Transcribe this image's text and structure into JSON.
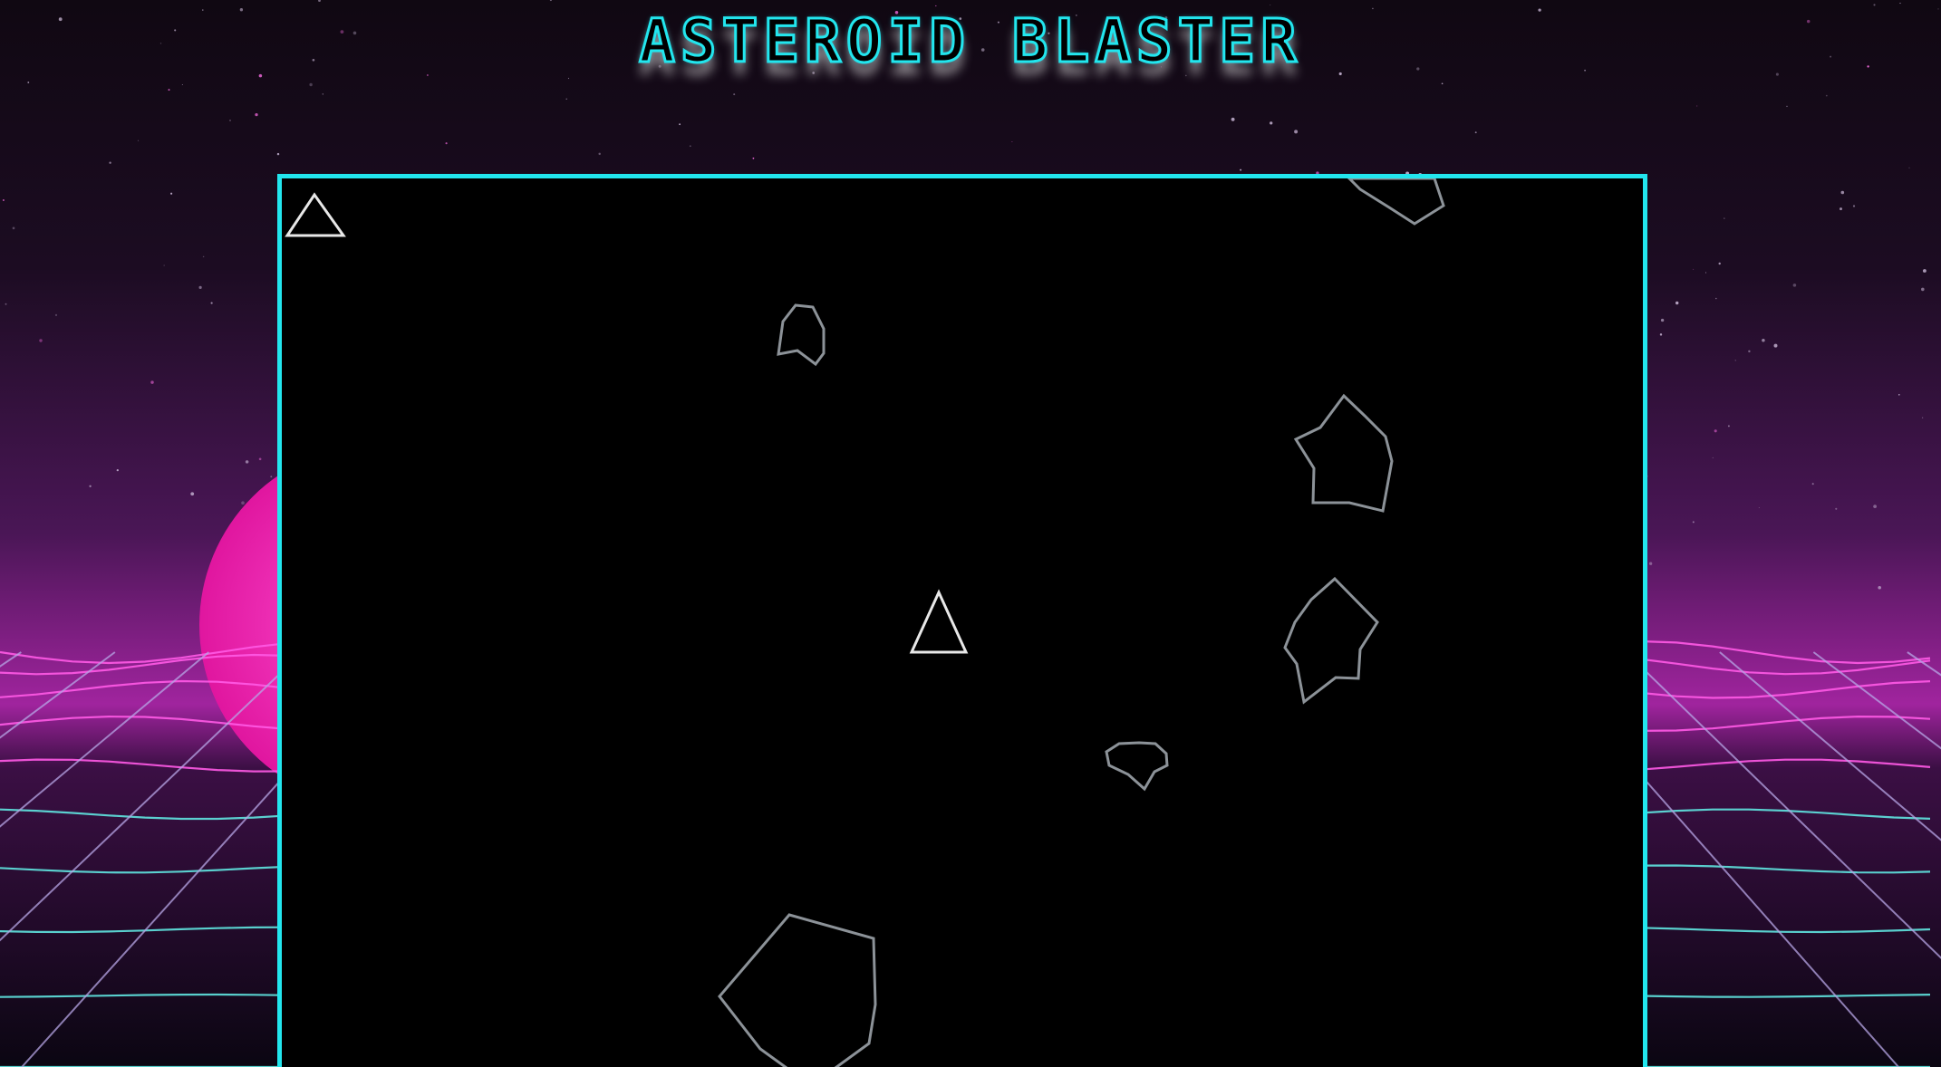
{
  "title": "ASTEROID BLASTER",
  "colors": {
    "accent": "#22e6ee",
    "magenta": "#ff2fd0",
    "sky_top": "#120914",
    "sky_mid": "#3a1448",
    "horizon": "#b02ab8",
    "asteroid_stroke": "#8c9298",
    "ship_stroke": "#e8e8e8",
    "canvas_bg": "#000000"
  },
  "hud": {
    "lives_icon": "ship-life-icon",
    "lives_count": 1
  },
  "game": {
    "player_ship": "triangle-ship-icon",
    "asteroid_count": 7
  }
}
